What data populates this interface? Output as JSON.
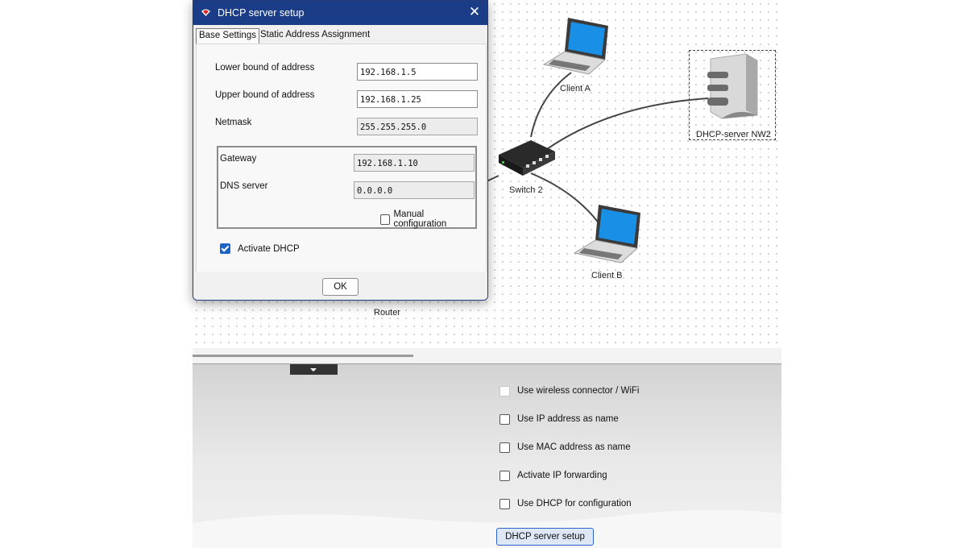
{
  "dialog": {
    "title": "DHCP server setup",
    "close_glyph": "✕",
    "tabs": [
      "Base Settings",
      "Static Address Assignment"
    ],
    "lower_bound_label": "Lower bound of address",
    "lower_bound_value": "192.168.1.5",
    "upper_bound_label": "Upper bound of address",
    "upper_bound_value": "192.168.1.25",
    "netmask_label": "Netmask",
    "netmask_value": "255.255.255.0",
    "gateway_label": "Gateway",
    "gateway_value": "192.168.1.10",
    "dns_label": "DNS server",
    "dns_value": "0.0.0.0",
    "manual_config_label": "Manual configuration",
    "manual_config_checked": false,
    "activate_dhcp_label": "Activate DHCP",
    "activate_dhcp_checked": true,
    "ok_label": "OK"
  },
  "network": {
    "devices": {
      "client_a": "Client A",
      "client_b": "Client B",
      "switch": "Switch 2",
      "router": "Router",
      "server": "DHCP-server NW2"
    }
  },
  "properties": {
    "options": [
      {
        "label": "Use wireless connector / WiFi",
        "checked": false
      },
      {
        "label": "Use IP address as name",
        "checked": false
      },
      {
        "label": "Use MAC address as name",
        "checked": false
      },
      {
        "label": "Activate IP forwarding",
        "checked": false
      },
      {
        "label": "Use DHCP for configuration",
        "checked": false
      }
    ],
    "dhcp_button_label": "DHCP server setup"
  },
  "colors": {
    "titlebar": "#1b3c86",
    "accent": "#1b63c8",
    "button_border": "#2b63c7"
  }
}
